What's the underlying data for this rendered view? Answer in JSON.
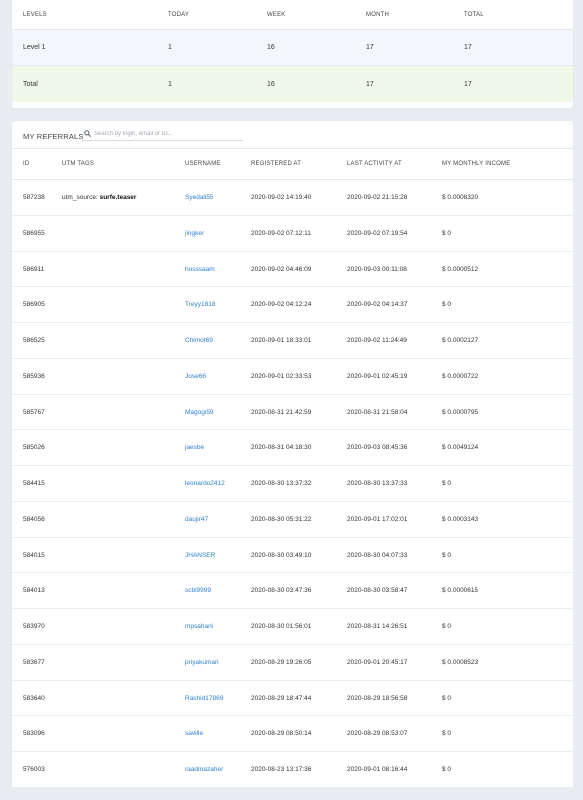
{
  "levels": {
    "headers": {
      "level": "LEVELS",
      "today": "TODAY",
      "week": "WEEK",
      "month": "MONTH",
      "total": "TOTAL"
    },
    "row": {
      "level": "Level 1",
      "today": "1",
      "week": "16",
      "month": "17",
      "total": "17"
    },
    "total_row": {
      "level": "Total",
      "today": "1",
      "week": "16",
      "month": "17",
      "total": "17"
    }
  },
  "referrals": {
    "title": "MY REFERRALS",
    "search": {
      "placeholder": "Search by login, email or ID...",
      "value": ""
    },
    "columns": {
      "id": "ID",
      "utm": "UTM TAGS",
      "username": "USERNAME",
      "registered": "REGISTERED AT",
      "activity": "LAST ACTIVITY AT",
      "income": "MY MONTHLY INCOME"
    },
    "rows": [
      {
        "id": "587238",
        "utm_key": "utm_source:",
        "utm_val": "surfe.teaser",
        "username": "Syedali55",
        "registered": "2020-09-02 14:19:40",
        "activity": "2020-09-02 21:15:28",
        "income": "$ 0.0008320"
      },
      {
        "id": "586955",
        "utm_key": "",
        "utm_val": "",
        "username": "jingker",
        "registered": "2020-09-02 07:12:11",
        "activity": "2020-09-02 07:19:54",
        "income": "$ 0"
      },
      {
        "id": "586911",
        "utm_key": "",
        "utm_val": "",
        "username": "hosssaam",
        "registered": "2020-09-02 04:46:09",
        "activity": "2020-09-03 00:11:08",
        "income": "$ 0.0000512"
      },
      {
        "id": "586905",
        "utm_key": "",
        "utm_val": "",
        "username": "Treyy1818",
        "registered": "2020-09-02 04:12:24",
        "activity": "2020-09-02 04:14:37",
        "income": "$ 0"
      },
      {
        "id": "586525",
        "utm_key": "",
        "utm_val": "",
        "username": "Chimot69",
        "registered": "2020-09-01 18:33:01",
        "activity": "2020-09-02 11:24:49",
        "income": "$ 0.0002127"
      },
      {
        "id": "585936",
        "utm_key": "",
        "utm_val": "",
        "username": "Jose66",
        "registered": "2020-09-01 02:33:53",
        "activity": "2020-09-01 02:45:19",
        "income": "$ 0.0000722"
      },
      {
        "id": "585767",
        "utm_key": "",
        "utm_val": "",
        "username": "Magogi59",
        "registered": "2020-08-31 21:42:59",
        "activity": "2020-08-31 21:58:04",
        "income": "$ 0.0000795"
      },
      {
        "id": "585026",
        "utm_key": "",
        "utm_val": "",
        "username": "jaesbe",
        "registered": "2020-08-31 04:18:30",
        "activity": "2020-09-03 08:45:36",
        "income": "$ 0.0049124"
      },
      {
        "id": "584415",
        "utm_key": "",
        "utm_val": "",
        "username": "leonardo2412",
        "registered": "2020-08-30 13:37:32",
        "activity": "2020-08-30 13:37:33",
        "income": "$ 0"
      },
      {
        "id": "584056",
        "utm_key": "",
        "utm_val": "",
        "username": "daujir47",
        "registered": "2020-08-30 05:31:22",
        "activity": "2020-09-01 17:02:01",
        "income": "$ 0.0003143"
      },
      {
        "id": "584015",
        "utm_key": "",
        "utm_val": "",
        "username": "JHANSER",
        "registered": "2020-08-30 03:49:10",
        "activity": "2020-08-30 04:07:33",
        "income": "$ 0"
      },
      {
        "id": "584013",
        "utm_key": "",
        "utm_val": "",
        "username": "scbi9999",
        "registered": "2020-08-30 03:47:36",
        "activity": "2020-08-30 03:58:47",
        "income": "$ 0.0000615"
      },
      {
        "id": "583970",
        "utm_key": "",
        "utm_val": "",
        "username": "mpsahani",
        "registered": "2020-08-30 01:56:01",
        "activity": "2020-08-31 14:26:51",
        "income": "$ 0"
      },
      {
        "id": "583677",
        "utm_key": "",
        "utm_val": "",
        "username": "priyakumari",
        "registered": "2020-08-29 19:26:05",
        "activity": "2020-09-01 20:45:17",
        "income": "$ 0.0008523"
      },
      {
        "id": "583640",
        "utm_key": "",
        "utm_val": "",
        "username": "Rashid17869",
        "registered": "2020-08-29 18:47:44",
        "activity": "2020-08-29 18:56:58",
        "income": "$ 0"
      },
      {
        "id": "583096",
        "utm_key": "",
        "utm_val": "",
        "username": "saville",
        "registered": "2020-08-29 08:50:14",
        "activity": "2020-08-29 08:53:07",
        "income": "$ 0"
      },
      {
        "id": "576003",
        "utm_key": "",
        "utm_val": "",
        "username": "raadmazaher",
        "registered": "2020-08-23 13:17:36",
        "activity": "2020-09-01 08:16:44",
        "income": "$ 0"
      }
    ]
  }
}
